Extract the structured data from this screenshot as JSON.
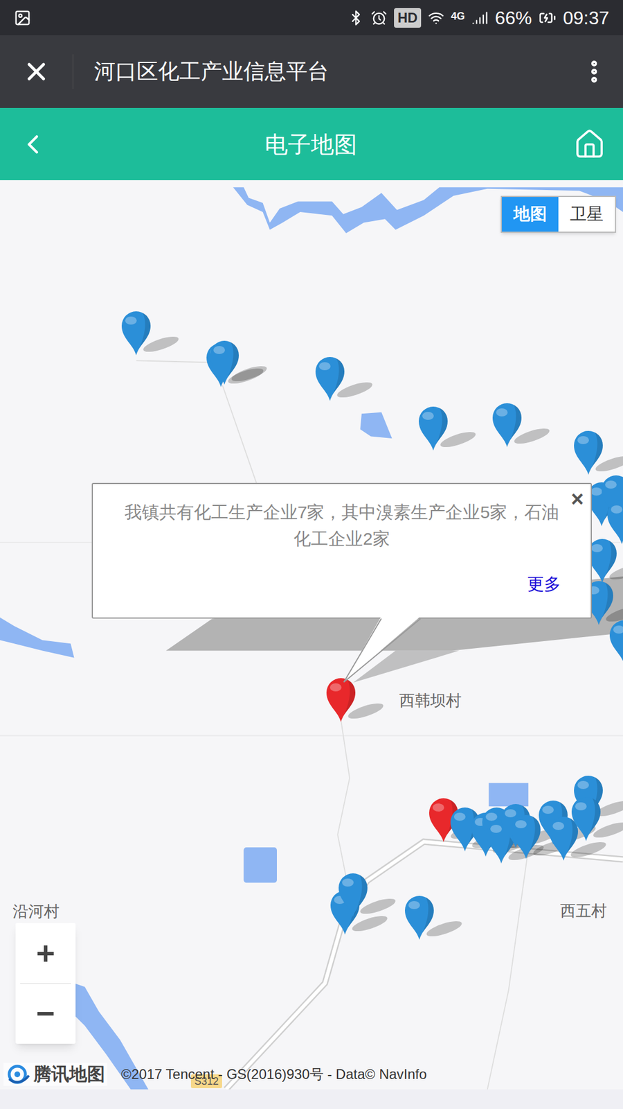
{
  "status_bar": {
    "hd": "HD",
    "network": "4G",
    "battery": "66%",
    "time": "09:37"
  },
  "window": {
    "title": "河口区化工产业信息平台"
  },
  "header": {
    "title": "电子地图"
  },
  "map_type_toggle": [
    {
      "label": "地图",
      "selected": true
    },
    {
      "label": "卫星",
      "selected": false
    }
  ],
  "map": {
    "labels": [
      "西韩坝村",
      "西五村",
      "沿河村"
    ],
    "road_label": "S312",
    "pins": [
      {
        "color": "#2b8fd8"
      },
      {
        "color": "#2b8fd8"
      },
      {
        "color": "#2b8fd8"
      },
      {
        "color": "#2b8fd8"
      },
      {
        "color": "#2b8fd8"
      },
      {
        "color": "#2b8fd8"
      },
      {
        "color": "#2b8fd8"
      },
      {
        "color": "#2b8fd8"
      },
      {
        "color": "#2b8fd8"
      },
      {
        "color": "#2b8fd8"
      },
      {
        "color": "#2b8fd8"
      },
      {
        "color": "#2b8fd8"
      },
      {
        "color": "#2b8fd8"
      },
      {
        "color": "#e8282b"
      },
      {
        "color": "#e8282b"
      },
      {
        "color": "#2b8fd8"
      },
      {
        "color": "#2b8fd8"
      },
      {
        "color": "#2b8fd8"
      },
      {
        "color": "#2b8fd8"
      },
      {
        "color": "#2b8fd8"
      },
      {
        "color": "#2b8fd8"
      },
      {
        "color": "#2b8fd8"
      },
      {
        "color": "#2b8fd8"
      },
      {
        "color": "#2b8fd8"
      },
      {
        "color": "#2b8fd8"
      },
      {
        "color": "#2b8fd8"
      },
      {
        "color": "#2b8fd8"
      },
      {
        "color": "#2b8fd8"
      }
    ]
  },
  "popup": {
    "text": "我镇共有化工生产企业7家，其中溴素生产企业5家，石油化工企业2家",
    "close": "×",
    "more": "更多"
  },
  "zoom": {
    "in": "+",
    "out": "−"
  },
  "attribution": {
    "logo": "腾讯地图",
    "copyright": "©2017 Tencent - GS(2016)930号 - Data© NavInfo"
  }
}
